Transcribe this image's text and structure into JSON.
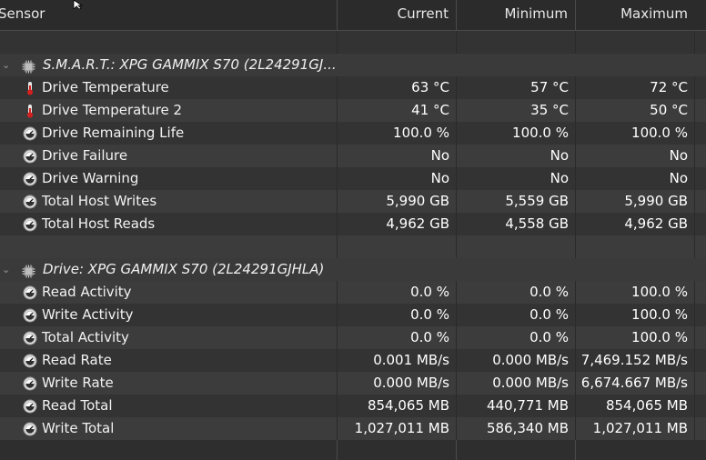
{
  "header": {
    "sensor": "Sensor",
    "current": "Current",
    "minimum": "Minimum",
    "maximum": "Maximum"
  },
  "groups": [
    {
      "title": "S.M.A.R.T.: XPG GAMMIX S70 (2L24291GJ...",
      "rows": [
        {
          "label": "Drive Temperature",
          "icon": "thermometer-icon",
          "current": "63 °C",
          "minimum": "57 °C",
          "maximum": "72 °C"
        },
        {
          "label": "Drive Temperature 2",
          "icon": "thermometer-icon",
          "current": "41 °C",
          "minimum": "35 °C",
          "maximum": "50 °C"
        },
        {
          "label": "Drive Remaining Life",
          "icon": "gauge-icon",
          "current": "100.0 %",
          "minimum": "100.0 %",
          "maximum": "100.0 %"
        },
        {
          "label": "Drive Failure",
          "icon": "gauge-icon",
          "current": "No",
          "minimum": "No",
          "maximum": "No"
        },
        {
          "label": "Drive Warning",
          "icon": "gauge-icon",
          "current": "No",
          "minimum": "No",
          "maximum": "No"
        },
        {
          "label": "Total Host Writes",
          "icon": "gauge-icon",
          "current": "5,990 GB",
          "minimum": "5,559 GB",
          "maximum": "5,990 GB"
        },
        {
          "label": "Total Host Reads",
          "icon": "gauge-icon",
          "current": "4,962 GB",
          "minimum": "4,558 GB",
          "maximum": "4,962 GB"
        }
      ]
    },
    {
      "title": "Drive: XPG GAMMIX S70 (2L24291GJHLA)",
      "rows": [
        {
          "label": "Read Activity",
          "icon": "gauge-icon",
          "current": "0.0 %",
          "minimum": "0.0 %",
          "maximum": "100.0 %"
        },
        {
          "label": "Write Activity",
          "icon": "gauge-icon",
          "current": "0.0 %",
          "minimum": "0.0 %",
          "maximum": "100.0 %"
        },
        {
          "label": "Total Activity",
          "icon": "gauge-icon",
          "current": "0.0 %",
          "minimum": "0.0 %",
          "maximum": "100.0 %"
        },
        {
          "label": "Read Rate",
          "icon": "gauge-icon",
          "current": "0.001 MB/s",
          "minimum": "0.000 MB/s",
          "maximum": "7,469.152 MB/s"
        },
        {
          "label": "Write Rate",
          "icon": "gauge-icon",
          "current": "0.000 MB/s",
          "minimum": "0.000 MB/s",
          "maximum": "6,674.667 MB/s"
        },
        {
          "label": "Read Total",
          "icon": "gauge-icon",
          "current": "854,065 MB",
          "minimum": "440,771 MB",
          "maximum": "854,065 MB"
        },
        {
          "label": "Write Total",
          "icon": "gauge-icon",
          "current": "1,027,011 MB",
          "minimum": "586,340 MB",
          "maximum": "1,027,011 MB"
        }
      ]
    }
  ]
}
